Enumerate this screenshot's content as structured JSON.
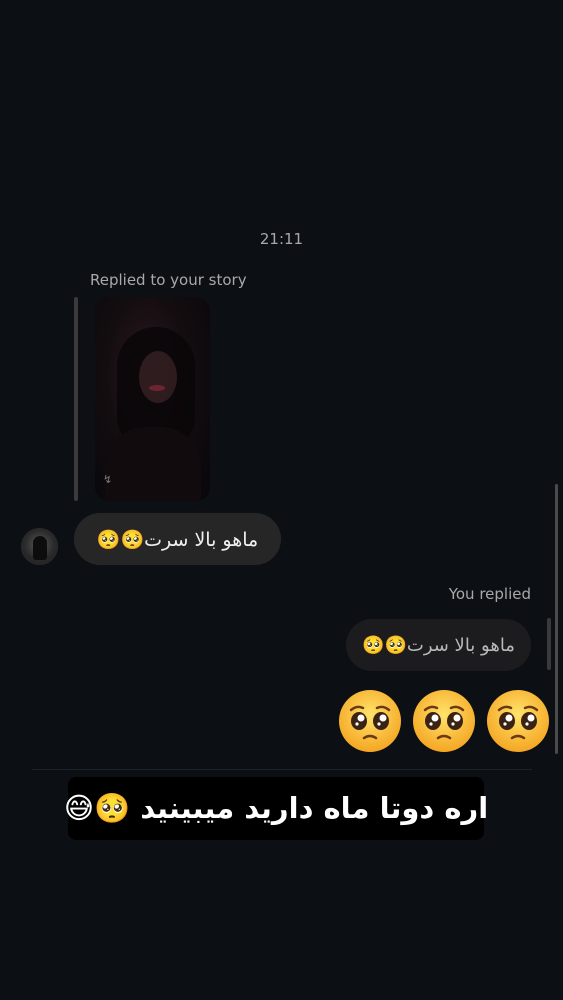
{
  "thread": {
    "timestamp": "21:11",
    "story_reply_label": "Replied to your story",
    "incoming_message": "ماهو بالا سرت🥺🥺",
    "you_replied_label": "You replied",
    "quoted_message": "ماهو بالا سرت🥺🥺",
    "big_emojis": [
      "pleading-face",
      "pleading-face",
      "pleading-face"
    ]
  },
  "overlay": {
    "caption": "اره دوتا ماه دارید میبینید 🥺😅"
  },
  "colors": {
    "background": "#0c1014",
    "incoming_bubble": "#262626",
    "secondary_text": "#a8a8a8",
    "caption_bg": "#000000"
  }
}
